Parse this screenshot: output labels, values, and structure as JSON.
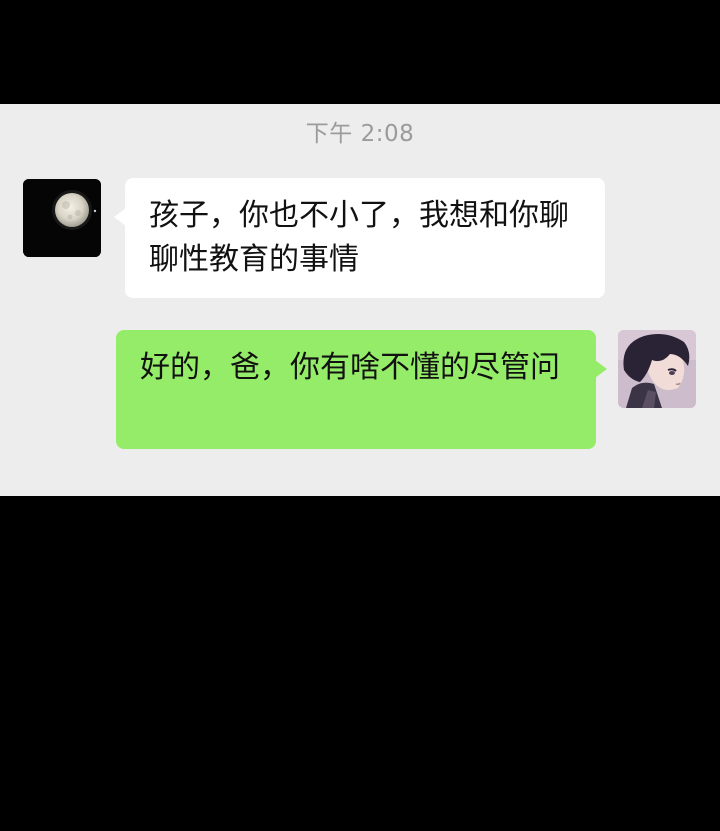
{
  "chat": {
    "timestamp": "下午 2:08",
    "messages": [
      {
        "sender": "other",
        "avatar_icon": "moon-avatar-icon",
        "text": "孩子，你也不小了，我想和你聊聊性教育的事情"
      },
      {
        "sender": "self",
        "avatar_icon": "anime-boy-avatar-icon",
        "text": "好的，爸，你有啥不懂的尽管问"
      }
    ]
  },
  "colors": {
    "page_background": "#000000",
    "chat_background": "#ededed",
    "incoming_bubble": "#ffffff",
    "outgoing_bubble": "#95ec69",
    "timestamp_text": "#9b9b9b"
  }
}
